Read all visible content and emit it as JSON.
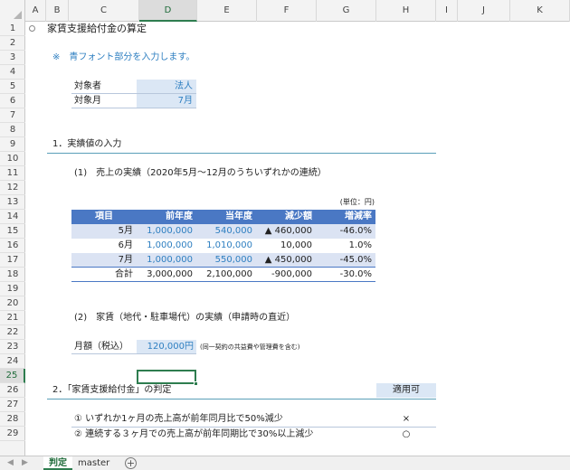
{
  "columns": [
    "A",
    "B",
    "C",
    "D",
    "E",
    "F",
    "G",
    "H",
    "I",
    "J",
    "K"
  ],
  "selected_column": "D",
  "rows": [
    "1",
    "2",
    "3",
    "4",
    "5",
    "6",
    "7",
    "8",
    "9",
    "10",
    "11",
    "12",
    "13",
    "14",
    "15",
    "16",
    "17",
    "18",
    "19",
    "20",
    "21",
    "22",
    "23",
    "24",
    "25",
    "26",
    "27",
    "28",
    "29"
  ],
  "selected_row": "25",
  "sheet": {
    "title": "家賃支援給付金の算定",
    "note": "※　青フォント部分を入力します。",
    "target_label": "対象者",
    "target_value": "法人",
    "month_label": "対象月",
    "month_value": "7月",
    "section1": "1．実績値の入力",
    "sub1": "(1)　売上の実績（2020年5月～12月のうちいずれかの連続）",
    "unit": "(単位：円)",
    "table": {
      "headers": [
        "項目",
        "前年度",
        "当年度",
        "減少額",
        "増減率"
      ],
      "rows": [
        [
          "5月",
          "1,000,000",
          "540,000",
          "▲ 460,000",
          "-46.0%"
        ],
        [
          "6月",
          "1,000,000",
          "1,010,000",
          "10,000",
          "1.0%"
        ],
        [
          "7月",
          "1,000,000",
          "550,000",
          "▲ 450,000",
          "-45.0%"
        ],
        [
          "合計",
          "3,000,000",
          "2,100,000",
          "-900,000",
          "-30.0%"
        ]
      ]
    },
    "sub2": "(2)　家賃（地代・駐車場代）の実績（申請時の直近）",
    "rent_label": "月額（税込）",
    "rent_value": "120,000円",
    "rent_note": "(同一契約の共益費や管理費を含む)",
    "section2": "2．「家賃支援給付金」の判定",
    "judge_header": "適用可",
    "cond1": "① いずれか1ヶ月の売上高が前年同月比で50%減少",
    "cond1_mark": "×",
    "cond2": "② 連続する３ヶ月での売上高が前年同期比で30%以上減少",
    "cond2_mark": "○"
  },
  "tabs": [
    "判定",
    "master"
  ],
  "active_tab": "判定",
  "colors": {
    "accent": "#2e7d4f",
    "blue_text": "#2e7fc1",
    "table_header": "#4a78c4",
    "input_fill": "#dbe7f5"
  }
}
